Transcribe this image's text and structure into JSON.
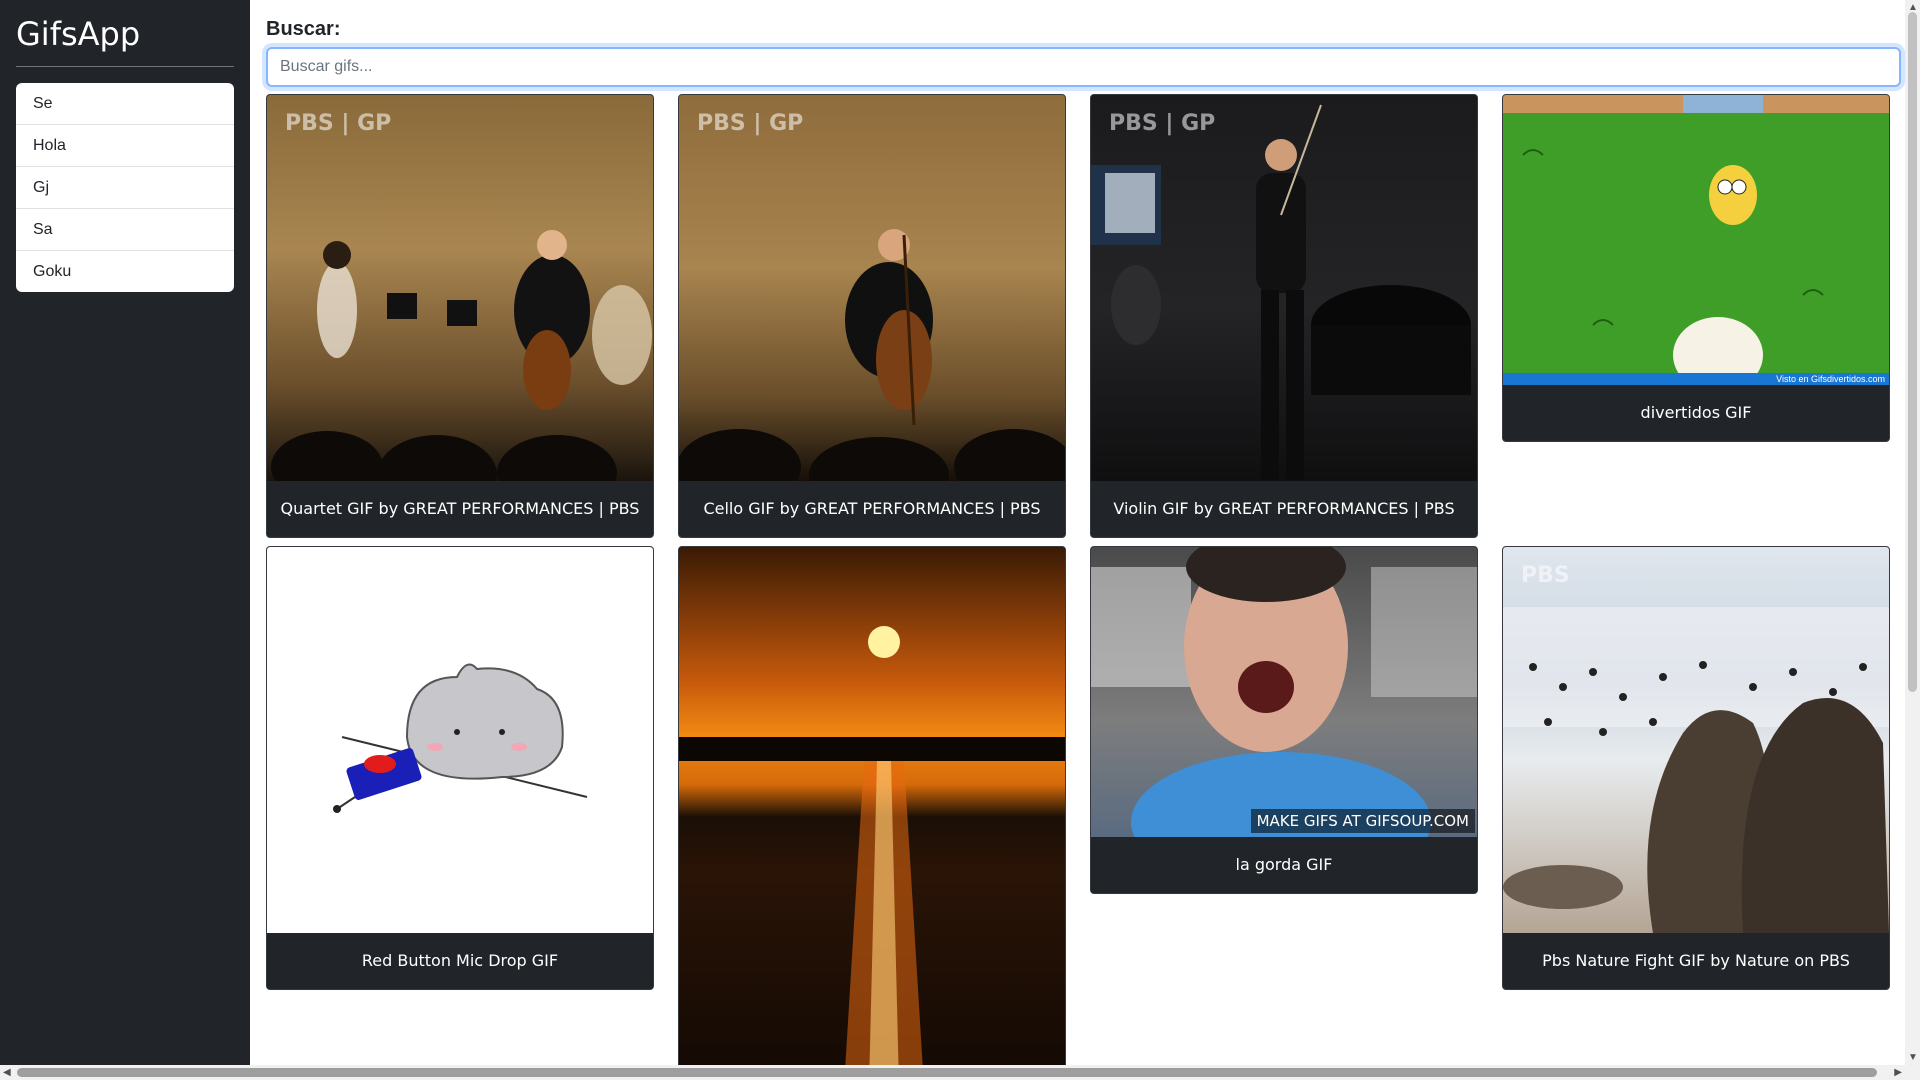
{
  "app": {
    "title": "GifsApp"
  },
  "history": [
    "Se",
    "Hola",
    "Gj",
    "Sa",
    "Goku"
  ],
  "search": {
    "label": "Buscar:",
    "placeholder": "Buscar gifs..."
  },
  "gifs": [
    {
      "title": "Quartet GIF by GREAT PERFORMANCES | PBS",
      "watermark": "PBS | GP"
    },
    {
      "title": "Cello GIF by GREAT PERFORMANCES | PBS",
      "watermark": "PBS | GP"
    },
    {
      "title": "Violin GIF by GREAT PERFORMANCES | PBS",
      "watermark": "PBS | GP"
    },
    {
      "title": "divertidos GIF",
      "watermark": "Visto en Gifsdivertidos.com"
    },
    {
      "title": "Red Button Mic Drop GIF"
    },
    {
      "title": ""
    },
    {
      "title": "la gorda GIF",
      "watermark": "MAKE GIFS AT GIFSOUP.COM"
    },
    {
      "title": "Pbs Nature Fight GIF by Nature on PBS",
      "watermark": "PBS"
    }
  ],
  "colors": {
    "sidebar": "#212529",
    "card": "#212529",
    "focus": "#86b7fe"
  }
}
